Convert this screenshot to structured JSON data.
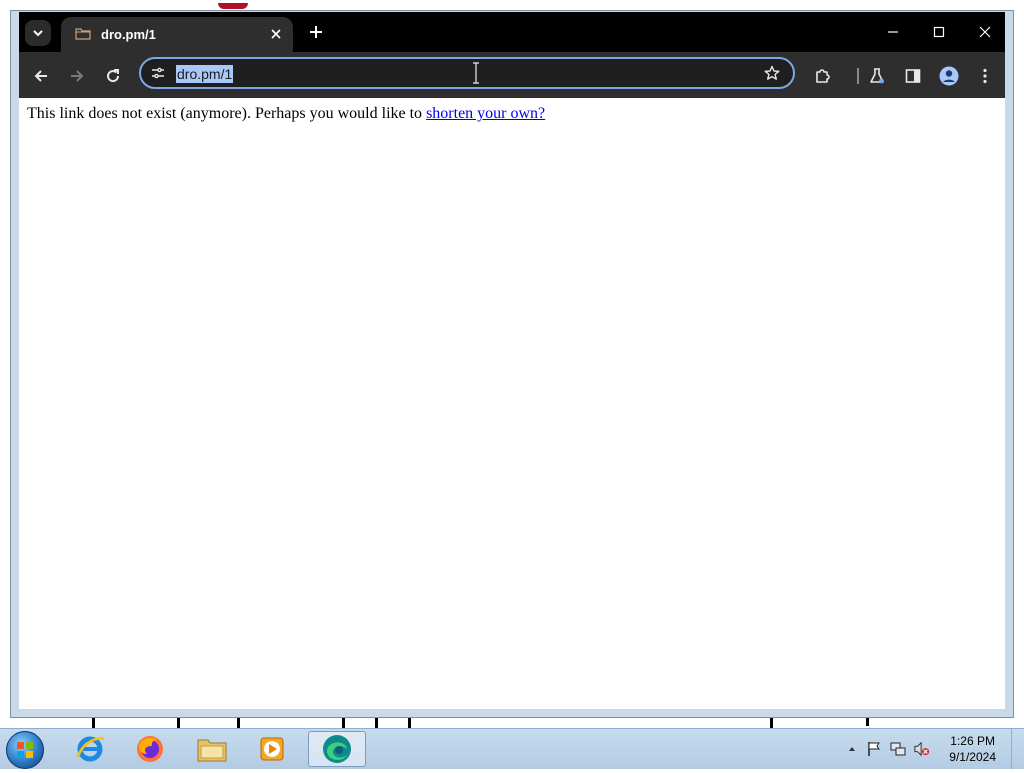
{
  "browser": {
    "tab": {
      "title": "dro.pm/1"
    },
    "address_bar": {
      "url": "dro.pm/1"
    }
  },
  "page": {
    "message_text": "This link does not exist (anymore). Perhaps you would like to ",
    "link_text": "shorten your own?"
  },
  "taskbar": {
    "clock": {
      "time": "1:26 PM",
      "date": "9/1/2024"
    }
  },
  "colors": {
    "tabstrip_bg": "#000000",
    "toolbar_bg": "#2e2e2e",
    "omnibox_border": "#7ca7e4",
    "url_selection": "#a8c7fa",
    "link": "#0000ee"
  }
}
